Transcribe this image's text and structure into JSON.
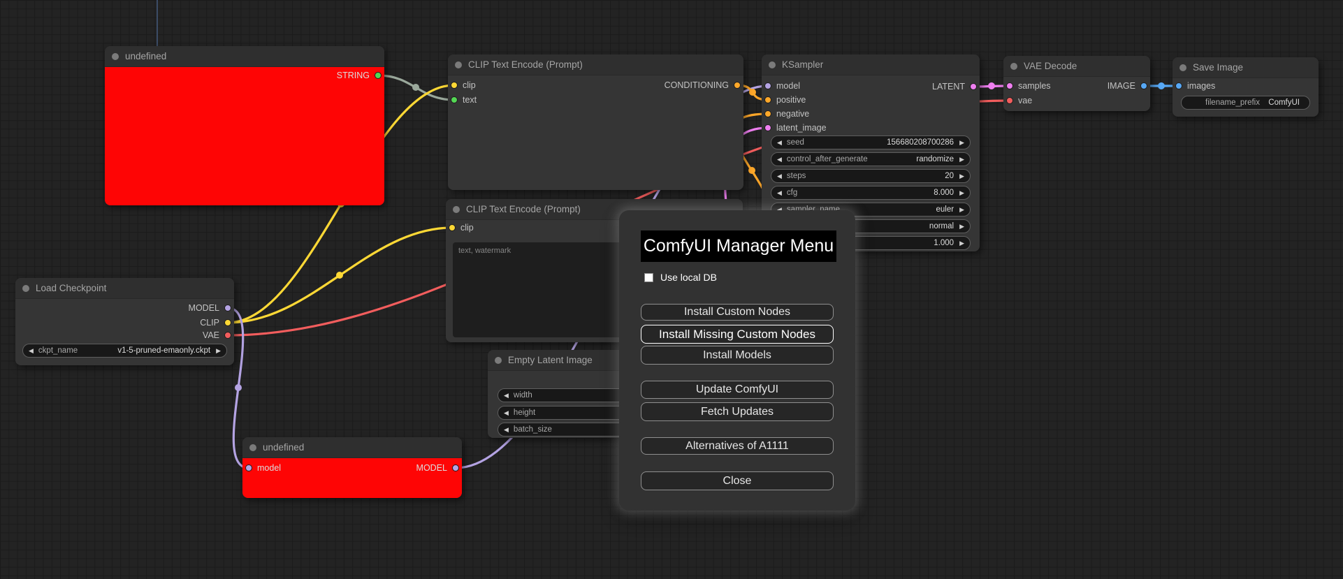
{
  "nodes": [
    {
      "title": "undefined",
      "outputs": [
        "STRING"
      ]
    },
    {
      "title": "CLIP Text Encode (Prompt)",
      "inputs": [
        "clip",
        "text"
      ],
      "outputs": [
        "CONDITIONING"
      ]
    },
    {
      "title": "KSampler",
      "inputs": [
        "model",
        "positive",
        "negative",
        "latent_image"
      ],
      "outputs": [
        "LATENT"
      ],
      "widgets": [
        {
          "label": "seed",
          "value": "156680208700286"
        },
        {
          "label": "control_after_generate",
          "value": "randomize"
        },
        {
          "label": "steps",
          "value": "20"
        },
        {
          "label": "cfg",
          "value": "8.000"
        },
        {
          "label": "sampler_name",
          "value": "euler"
        },
        {
          "label": "",
          "value": "normal"
        },
        {
          "label": "",
          "value": "1.000"
        }
      ]
    },
    {
      "title": "VAE Decode",
      "inputs": [
        "samples",
        "vae"
      ],
      "outputs": [
        "IMAGE"
      ]
    },
    {
      "title": "Save Image",
      "inputs": [
        "images"
      ],
      "widgets": [
        {
          "label": "filename_prefix",
          "value": "ComfyUI"
        }
      ]
    },
    {
      "title": "Load Checkpoint",
      "outputs": [
        "MODEL",
        "CLIP",
        "VAE"
      ],
      "widgets": [
        {
          "label": "ckpt_name",
          "value": "v1-5-pruned-emaonly.ckpt"
        }
      ]
    },
    {
      "title": "CLIP Text Encode (Prompt)",
      "inputs": [
        "clip"
      ],
      "text": "text, watermark"
    },
    {
      "title": "Empty Latent Image",
      "widgets": [
        {
          "label": "width"
        },
        {
          "label": "height"
        },
        {
          "label": "batch_size"
        }
      ]
    },
    {
      "title": "undefined",
      "inputs": [
        "model"
      ],
      "outputs": [
        "MODEL"
      ]
    }
  ],
  "widget_arrows": {
    "left": "◀",
    "right": "▶"
  },
  "dialog": {
    "title": "ComfyUI Manager Menu",
    "checkbox_label": "Use local DB",
    "checkbox_checked": false,
    "buttons": [
      "Install Custom Nodes",
      "Install Missing Custom Nodes",
      "Install Models",
      "Update ComfyUI",
      "Fetch Updates",
      "Alternatives of A1111",
      "Close"
    ]
  },
  "colors": {
    "canvas_bg": "#232323",
    "node_body": "#353535",
    "node_title_bg": "#2f2f2f",
    "node_error_red": "#fe0505",
    "link_string_wire": "#9aa89b",
    "slot_string_green": "#54d754",
    "slot_clip_yellow": "#fdd835",
    "slot_conditioning_orange": "#ffa82a",
    "slot_model_purple": "#b4a3e3",
    "slot_latent_pink": "#ef7ff0",
    "slot_vae_red": "#f25d5d",
    "slot_image_blue": "#57a8f5",
    "dialog_title_bg": "#000000"
  }
}
